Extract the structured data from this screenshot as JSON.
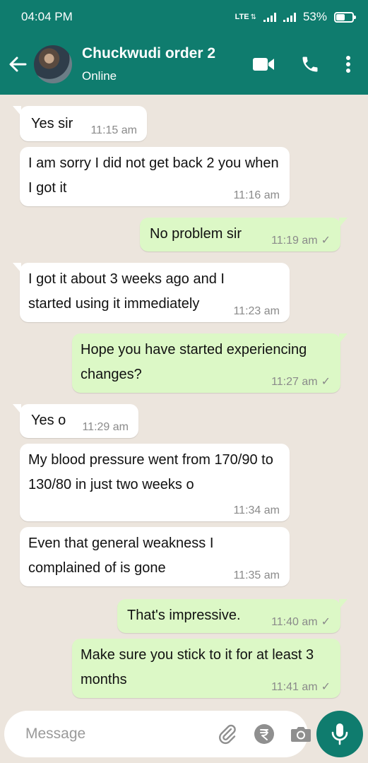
{
  "status_bar": {
    "time": "04:04 PM",
    "network": "LTE",
    "battery": "53%"
  },
  "header": {
    "contact_name": "Chuckwudi order 2",
    "contact_status": "Online"
  },
  "messages": [
    {
      "text": "Yes sir",
      "time": "11:15 am",
      "direction": "in"
    },
    {
      "text": "I am sorry I did not get back 2 you when I got it",
      "time": "11:16 am",
      "direction": "in"
    },
    {
      "text": "No problem sir",
      "time": "11:19 am",
      "direction": "out"
    },
    {
      "text": "I got it about 3 weeks ago and I started using it immediately",
      "time": "11:23 am",
      "direction": "in"
    },
    {
      "text": "Hope you have started experiencing changes?",
      "time": "11:27 am",
      "direction": "out"
    },
    {
      "text": "Yes o",
      "time": "11:29 am",
      "direction": "in"
    },
    {
      "text": "My blood pressure went from 170/90 to 130/80 in just two weeks o",
      "time": "11:34 am",
      "direction": "in"
    },
    {
      "text": "Even that general weakness I complained of is gone",
      "time": "11:35 am",
      "direction": "in"
    },
    {
      "text": "That's impressive.",
      "time": "11:40 am",
      "direction": "out"
    },
    {
      "text": "Make sure you stick to it for at least 3 months",
      "time": "11:41 am",
      "direction": "out"
    }
  ],
  "composer": {
    "placeholder": "Message"
  },
  "colors": {
    "primary": "#0f7c6e",
    "outgoing_bubble": "#dcf8c6",
    "incoming_bubble": "#ffffff",
    "chat_background": "#ece5dd"
  }
}
